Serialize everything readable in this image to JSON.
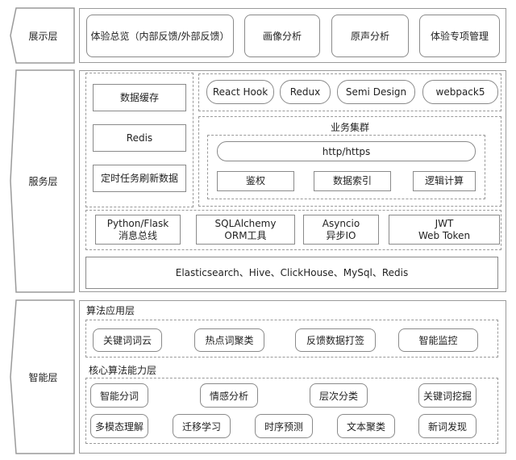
{
  "layers": {
    "presentation": {
      "label": "展示层",
      "items": [
        "体验总览（内部反馈/外部反馈）",
        "画像分析",
        "原声分析",
        "体验专项管理"
      ]
    },
    "service": {
      "label": "服务层",
      "cache": [
        "数据缓存",
        "Redis",
        "定时任务刷新数据"
      ],
      "frontend": [
        "React Hook",
        "Redux",
        "Semi Design",
        "webpack5"
      ],
      "cluster": {
        "title": "业务集群",
        "protocol": "http/https",
        "items": [
          "鉴权",
          "数据索引",
          "逻辑计算"
        ]
      },
      "backend": [
        {
          "line1": "Python/Flask",
          "line2": "消息总线"
        },
        {
          "line1": "SQLAlchemy",
          "line2": "ORM工具"
        },
        {
          "line1": "Asyncio",
          "line2": "异步IO"
        },
        {
          "line1": "JWT",
          "line2": "Web Token"
        }
      ],
      "storage": "Elasticsearch、Hive、ClickHouse、MySql、Redis"
    },
    "intelligence": {
      "label": "智能层",
      "app_title": "算法应用层",
      "app_items": [
        "关键词词云",
        "热点词聚类",
        "反馈数据打签",
        "智能监控"
      ],
      "core_title": "核心算法能力层",
      "core_row1": [
        "智能分词",
        "情感分析",
        "层次分类",
        "关键词挖掘"
      ],
      "core_row2": [
        "多模态理解",
        "迁移学习",
        "时序预测",
        "文本聚类",
        "新词发现"
      ]
    }
  }
}
